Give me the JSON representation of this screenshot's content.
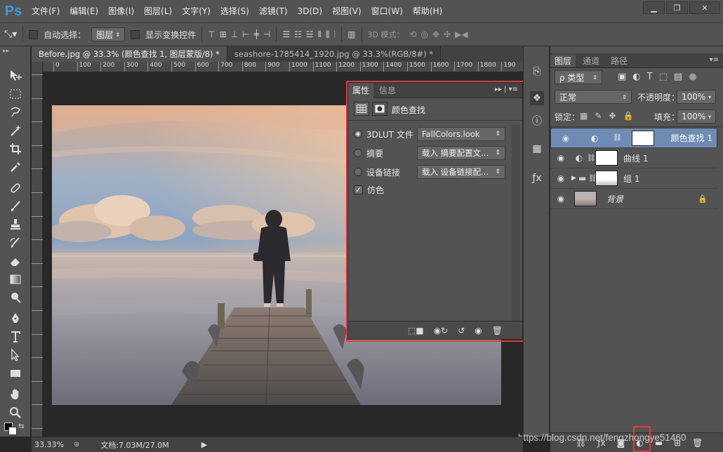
{
  "app": {
    "logo": "Ps"
  },
  "menu": [
    "文件(F)",
    "编辑(E)",
    "图像(I)",
    "图层(L)",
    "文字(Y)",
    "选择(S)",
    "滤镜(T)",
    "3D(D)",
    "视图(V)",
    "窗口(W)",
    "帮助(H)"
  ],
  "window_controls": {
    "minimize": "▁",
    "maximize": "❐",
    "close": "✕"
  },
  "options": {
    "auto_select_label": "自动选择：",
    "auto_select_value": "图层",
    "show_transform_label": "显示变换控件",
    "mode_3d_label": "3D 模式："
  },
  "tabs": [
    {
      "label": "Before.jpg @ 33.3% (颜色查找 1, 图层蒙版/8) *",
      "active": true
    },
    {
      "label": "seashore-1785414_1920.jpg @ 33.3%(RGB/8#) *",
      "active": false
    }
  ],
  "ruler_ticks": [
    "0",
    "100",
    "200",
    "300",
    "400",
    "500",
    "600",
    "700",
    "800",
    "900",
    "1000",
    "1100",
    "1200",
    "1300",
    "1400",
    "1500",
    "1600",
    "1700",
    "1800",
    "190"
  ],
  "properties": {
    "tabs": [
      "属性",
      "信息"
    ],
    "title": "颜色查找",
    "rows": [
      {
        "label": "3DLUT 文件",
        "value": "FallColors.look",
        "selected": true
      },
      {
        "label": "摘要",
        "value": "载入 摘要配置文...",
        "selected": false
      },
      {
        "label": "设备链接",
        "value": "载入 设备链接配...",
        "selected": false
      }
    ],
    "dither_label": "仿色",
    "dither_checked": true
  },
  "layers": {
    "tabs": [
      "图层",
      "通道",
      "路径"
    ],
    "filter_label": "ρ 类型",
    "blend_mode": "正常",
    "opacity_label": "不透明度：",
    "opacity_value": "100%",
    "lock_label": "锁定：",
    "fill_label": "填充：",
    "fill_value": "100%",
    "items": [
      {
        "name": "颜色查找 1",
        "selected": true,
        "type": "adjustment"
      },
      {
        "name": "曲线 1",
        "selected": false,
        "type": "adjustment"
      },
      {
        "name": "组 1",
        "selected": false,
        "type": "group"
      },
      {
        "name": "背景",
        "selected": false,
        "type": "background"
      }
    ]
  },
  "status": {
    "zoom": "33.33%",
    "doc": "文档:7.03M/27.0M"
  },
  "watermark": "https://blog.csdn.net/fengzhongye51460",
  "colors": {
    "accent_selected": "#6e8bb3",
    "highlight_frame": "#e03a3a",
    "logo": "#3a9ad9"
  }
}
